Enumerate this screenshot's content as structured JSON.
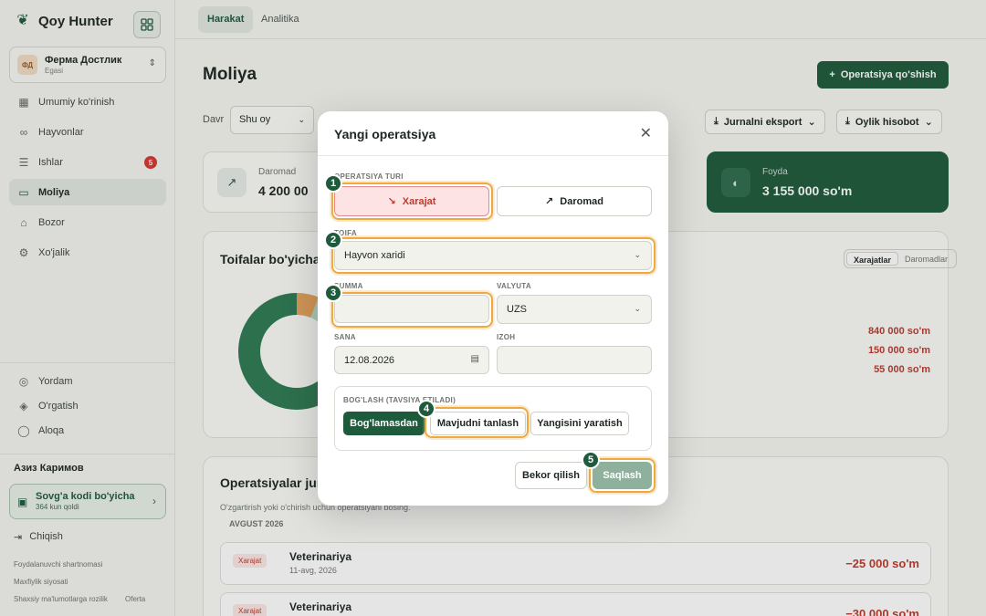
{
  "brand": {
    "name": "Qoy Hunter"
  },
  "farm": {
    "badge": "ФД",
    "name": "Ферма Достлик",
    "role": "Egasi"
  },
  "nav": [
    {
      "label": "Umumiy ko'rinish",
      "icon": "grid-icon"
    },
    {
      "label": "Hayvonlar",
      "icon": "paw-icon"
    },
    {
      "label": "Ishlar",
      "icon": "tasks-icon",
      "badge": "5"
    },
    {
      "label": "Moliya",
      "icon": "wallet-icon"
    },
    {
      "label": "Bozor",
      "icon": "store-icon"
    },
    {
      "label": "Xo'jalik",
      "icon": "settings-icon"
    }
  ],
  "help": [
    {
      "label": "Yordam",
      "icon": "help-icon"
    },
    {
      "label": "O'rgatish",
      "icon": "graduation-icon"
    },
    {
      "label": "Aloqa",
      "icon": "chat-icon"
    }
  ],
  "user": {
    "name": "Азиз Каримов"
  },
  "gift": {
    "title": "Sovg'a kodi bo'yicha",
    "sub": "364 kun qoldi"
  },
  "logout": "Chiqish",
  "legal": {
    "terms": "Foydalanuvchi shartnomasi",
    "privacy": "Maxfiylik siyosati",
    "consent": "Shaxsiy ma'lumotlarga rozilik",
    "offer": "Oferta"
  },
  "tabs": [
    "Harakat",
    "Analitika"
  ],
  "page": {
    "title": "Moliya",
    "add_button": "Operatsiya qo'shish",
    "period_label": "Davr",
    "period_value": "Shu oy",
    "export_button": "Jurnalni eksport",
    "report_button": "Oylik hisobot"
  },
  "stats": {
    "income": {
      "label": "Daromad",
      "value": "4 200 00"
    },
    "profit": {
      "label": "Foyda",
      "value": "3 155 000 so'm"
    }
  },
  "categories": {
    "title": "Toifalar bo'yicha",
    "toggle_expenses": "Xarajatlar",
    "toggle_income": "Daromadlar",
    "values": [
      "840 000 so'm",
      "150 000 so'm",
      "55 000 so'm"
    ]
  },
  "operations": {
    "title": "Operatsiyalar jur",
    "subtitle": "O'zgartirish yoki o'chirish uchun operatsiyani bosing.",
    "month": "AVGUST 2026",
    "rows": [
      {
        "tag": "Xarajat",
        "name": "Veterinariya",
        "date": "11-avg, 2026",
        "amount": "−25 000 so'm"
      },
      {
        "tag": "Xarajat",
        "name": "Veterinariya",
        "date": "",
        "amount": "−30 000 so'm"
      }
    ]
  },
  "modal": {
    "title": "Yangi operatsiya",
    "type_label": "OPERATSIYA TURI",
    "expense": "Xarajat",
    "income": "Daromad",
    "category_label": "TOIFA",
    "category_value": "Hayvon xaridi",
    "sum_label": "SUMMA",
    "sum_value": "",
    "currency_label": "VALYUTA",
    "currency_value": "UZS",
    "date_label": "SANA",
    "date_value": "12.08.2026",
    "note_label": "IZOH",
    "note_value": "",
    "link_label": "BOG'LASH (TAVSIYA ETILADI)",
    "link_none": "Bog'lamasdan",
    "link_existing": "Mavjudni tanlash",
    "link_new": "Yangisini yaratish",
    "cancel": "Bekor qilish",
    "save": "Saqlash"
  },
  "steps": [
    "1",
    "2",
    "3",
    "4",
    "5"
  ],
  "colors": {
    "primary": "#1e5a3c",
    "expense": "#c0392b",
    "highlight": "#f0a93f"
  }
}
